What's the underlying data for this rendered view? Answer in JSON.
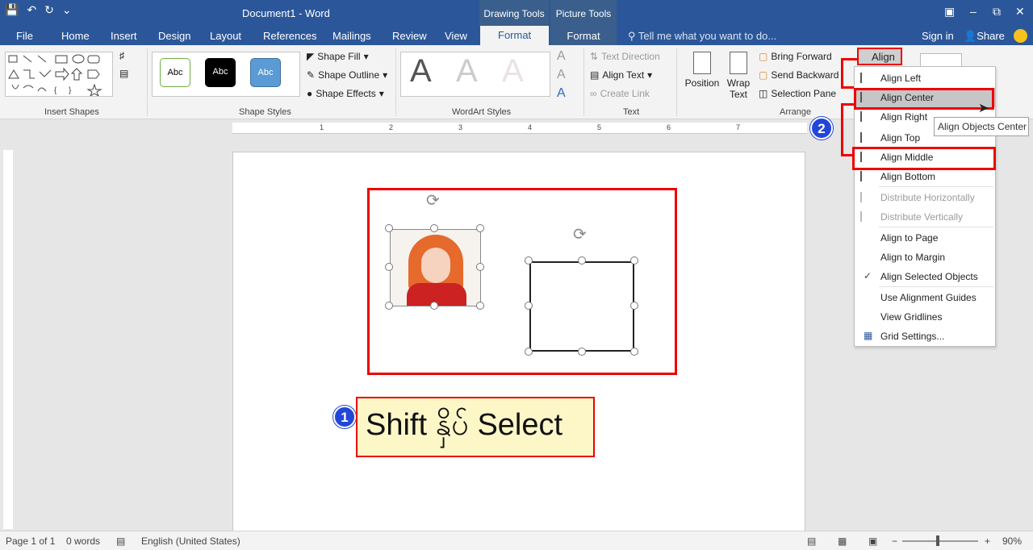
{
  "titlebar": {
    "doc_title": "Document1 - Word",
    "context_drawing": "Drawing Tools",
    "context_picture": "Picture Tools",
    "save_icon": "save-icon",
    "undo_icon": "undo-icon",
    "redo_icon": "redo-icon"
  },
  "tabs": {
    "file": "File",
    "home": "Home",
    "insert": "Insert",
    "design": "Design",
    "layout": "Layout",
    "references": "References",
    "mailings": "Mailings",
    "review": "Review",
    "view": "View",
    "format_drawing": "Format",
    "format_picture": "Format",
    "tell_me": "Tell me what you want to do...",
    "sign_in": "Sign in",
    "share": "Share"
  },
  "ribbon": {
    "insert_shapes_label": "Insert Shapes",
    "shape_styles_label": "Shape Styles",
    "style_sample_1": "Abc",
    "style_sample_2": "Abc",
    "style_sample_3": "Abc",
    "shape_fill": "Shape Fill",
    "shape_outline": "Shape Outline",
    "shape_effects": "Shape Effects",
    "wordart_styles_label": "WordArt Styles",
    "wordart_letter": "A",
    "text_direction": "Text Direction",
    "align_text": "Align Text",
    "create_link": "Create Link",
    "text_label": "Text",
    "position": "Position",
    "wrap_text_line1": "Wrap",
    "wrap_text_line2": "Text",
    "bring_forward": "Bring Forward",
    "send_backward": "Send Backward",
    "selection_pane": "Selection Pane",
    "arrange_label": "Arrange",
    "align": "Align"
  },
  "ruler": {
    "marks": [
      "1",
      "2",
      "3",
      "4",
      "5",
      "6",
      "7"
    ]
  },
  "callout": {
    "text": "Shift နှိပ် Select",
    "badge_1": "1",
    "badge_2": "2"
  },
  "align_menu": {
    "items": [
      {
        "label": "Align Left",
        "disabled": false
      },
      {
        "label": "Align Center",
        "disabled": false,
        "highlighted": true
      },
      {
        "label": "Align Right",
        "disabled": false
      },
      {
        "label": "Align Top",
        "disabled": false
      },
      {
        "label": "Align Middle",
        "disabled": false
      },
      {
        "label": "Align Bottom",
        "disabled": false
      },
      {
        "label": "Distribute Horizontally",
        "disabled": true
      },
      {
        "label": "Distribute Vertically",
        "disabled": true
      },
      {
        "label": "Align to Page",
        "disabled": false
      },
      {
        "label": "Align to Margin",
        "disabled": false
      },
      {
        "label": "Align Selected Objects",
        "disabled": false,
        "checked": true
      },
      {
        "label": "Use Alignment Guides",
        "disabled": false
      },
      {
        "label": "View Gridlines",
        "disabled": false
      },
      {
        "label": "Grid Settings...",
        "disabled": false
      }
    ],
    "tooltip": "Align Objects Center"
  },
  "statusbar": {
    "page": "Page 1 of 1",
    "words": "0 words",
    "language": "English (United States)",
    "zoom": "90%"
  },
  "colors": {
    "word_blue": "#2b579a",
    "highlight_red": "#e00000",
    "callout_bg": "#fdf7c7",
    "badge_blue": "#2246d8"
  }
}
